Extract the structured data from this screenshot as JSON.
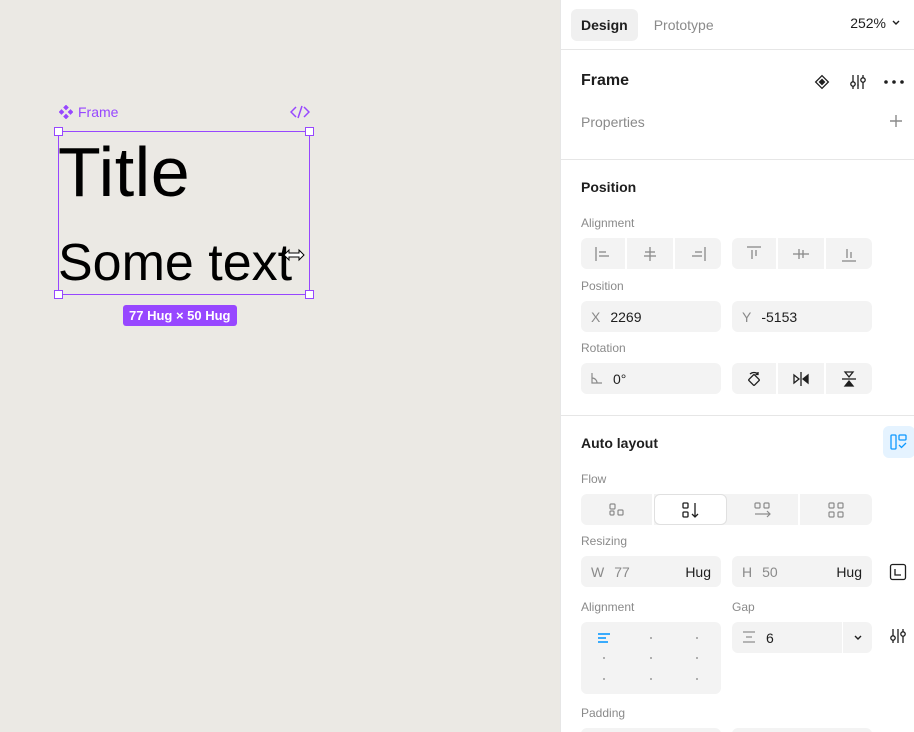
{
  "canvas": {
    "frame_label": "Frame",
    "title_text": "Title",
    "body_text": "Some text",
    "size_badge": "77 Hug × 50 Hug"
  },
  "topbar": {
    "tabs": [
      {
        "label": "Design"
      },
      {
        "label": "Prototype"
      }
    ],
    "zoom": "252%"
  },
  "frame_section": {
    "name": "Frame",
    "properties_label": "Properties"
  },
  "position_section": {
    "title": "Position",
    "alignment_label": "Alignment",
    "position_label": "Position",
    "x_prefix": "X",
    "x_value": "2269",
    "y_prefix": "Y",
    "y_value": "-5153",
    "rotation_label": "Rotation",
    "rotation_value": "0°"
  },
  "auto_layout_section": {
    "title": "Auto layout",
    "flow_label": "Flow",
    "resizing_label": "Resizing",
    "w_prefix": "W",
    "w_value": "77",
    "w_mode": "Hug",
    "h_prefix": "H",
    "h_value": "50",
    "h_mode": "Hug",
    "alignment_label": "Alignment",
    "gap_label": "Gap",
    "gap_value": "6",
    "padding_label": "Padding"
  },
  "colors": {
    "selection": "#9747ff",
    "accent_blue": "#0d99ff",
    "canvas_bg": "#ebe9e4"
  }
}
